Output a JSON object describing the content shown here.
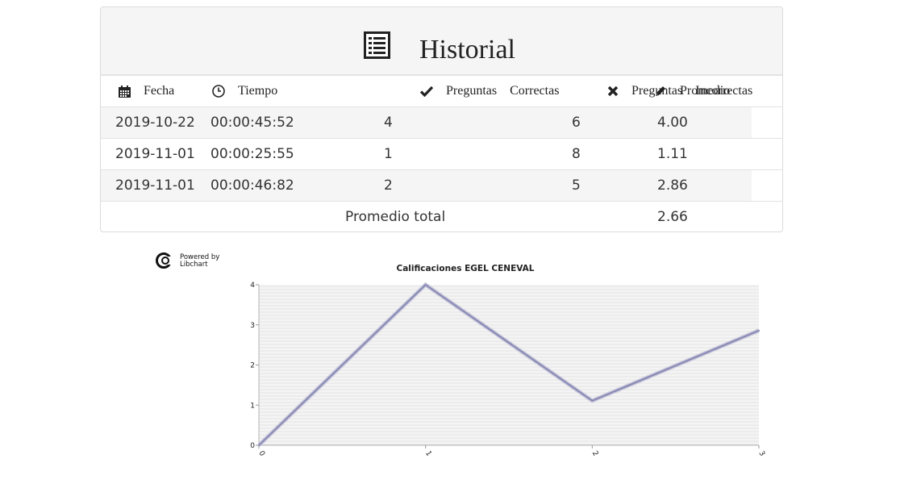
{
  "header": {
    "title": "Historial",
    "title_icon": "list-icon"
  },
  "table": {
    "columns": [
      {
        "icon": "calendar-icon",
        "words": [
          "Fecha"
        ]
      },
      {
        "icon": "clock-icon",
        "words": [
          "Tiempo"
        ]
      },
      {
        "icon": "checkmark-icon",
        "words": [
          "Preguntas",
          "Correctas"
        ]
      },
      {
        "icon": "x-icon",
        "words": [
          "Preguntas",
          "Incorrectas"
        ]
      },
      {
        "icon": "pencil-icon",
        "words": [
          "Promedio"
        ]
      }
    ],
    "rows": [
      {
        "fecha": "2019-10-22",
        "tiempo": "00:00:45:52",
        "correctas": "4",
        "incorrectas": "6",
        "promedio": "4.00"
      },
      {
        "fecha": "2019-11-01",
        "tiempo": "00:00:25:55",
        "correctas": "1",
        "incorrectas": "8",
        "promedio": "1.11"
      },
      {
        "fecha": "2019-11-01",
        "tiempo": "00:00:46:82",
        "correctas": "2",
        "incorrectas": "5",
        "promedio": "2.86"
      }
    ],
    "footer": {
      "label": "Promedio total",
      "value": "2.66"
    }
  },
  "logo": {
    "line1": "Powered by",
    "line2": "Libchart"
  },
  "chart_data": {
    "type": "line",
    "title": "Calificaciones EGEL CENEVAL",
    "x": [
      0,
      1,
      2,
      3
    ],
    "series": [
      {
        "values": [
          0,
          4.0,
          1.11,
          2.86
        ]
      }
    ],
    "xlim": [
      0,
      3
    ],
    "ylim": [
      0,
      4
    ],
    "xticks": [
      "0",
      "1",
      "2",
      "3"
    ],
    "yticks": [
      "0",
      "1",
      "2",
      "3",
      "4"
    ],
    "line_color": "#8a8ab5",
    "grid": true
  }
}
